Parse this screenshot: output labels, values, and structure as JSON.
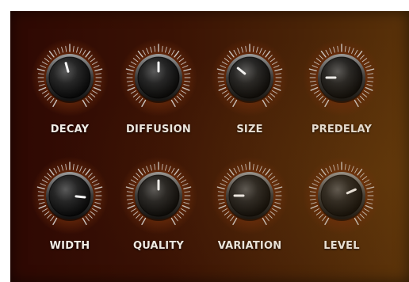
{
  "knobs": [
    {
      "label": "DECAY",
      "value": 0.45,
      "color_accent": "#f2f2f2"
    },
    {
      "label": "DIFFUSION",
      "value": 0.5
    },
    {
      "label": "SIZE",
      "value": 0.33
    },
    {
      "label": "PREDELAY",
      "value": 0.2
    },
    {
      "label": "WIDTH",
      "value": 0.82
    },
    {
      "label": "QUALITY",
      "value": 0.5
    },
    {
      "label": "VARIATION",
      "value": 0.2
    },
    {
      "label": "LEVEL",
      "value": 0.72
    }
  ],
  "colors": {
    "panel_dark": "#2e0803",
    "panel_light": "#5a3209",
    "knob_body": "#1a1a1a",
    "tick": "#d8d8d8",
    "label": "#f1ece6",
    "glow": "#6a2a0a"
  }
}
